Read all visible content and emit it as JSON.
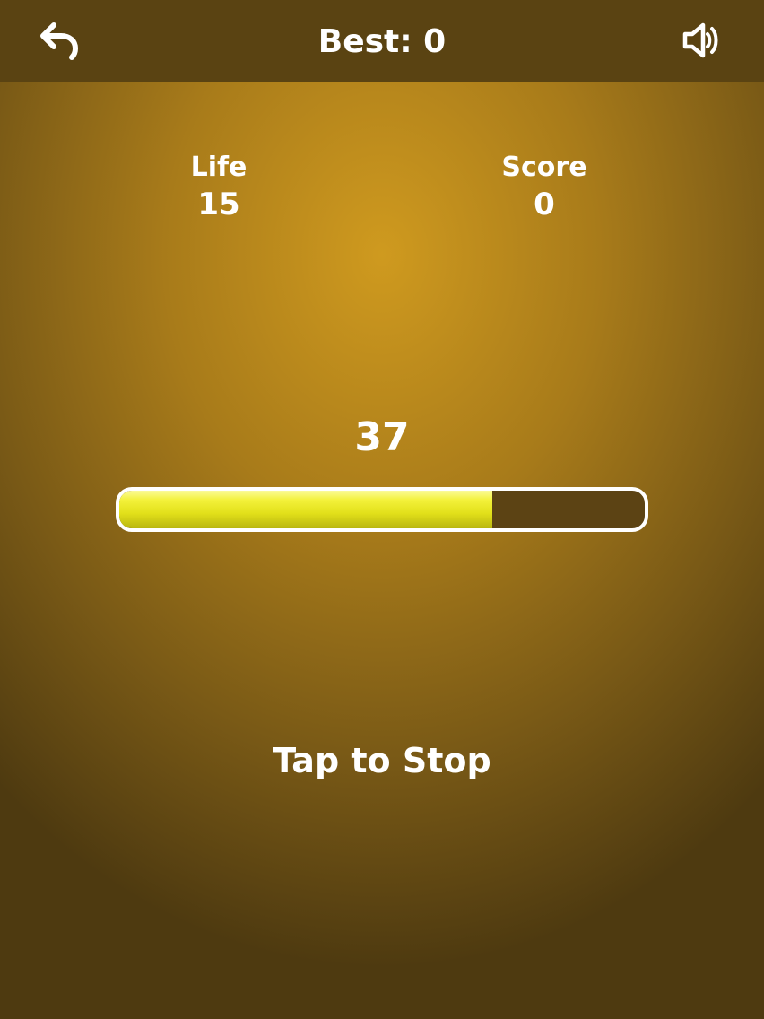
{
  "header": {
    "best_label": "Best: 0",
    "back_icon": "undo-arrow-icon",
    "sound_icon": "speaker-volume-icon"
  },
  "stats": {
    "life_label": "Life",
    "life_value": "15",
    "score_label": "Score",
    "score_value": "0"
  },
  "power": {
    "value": "37",
    "fill_percent": 71
  },
  "prompt": "Tap to Stop",
  "colors": {
    "header_bg": "#5a4312",
    "background_center": "#cf9a1f",
    "background_edge": "#4e3a10",
    "bar_fill": "#e9e72a",
    "bar_track": "#5c4314",
    "text": "#ffffff"
  }
}
